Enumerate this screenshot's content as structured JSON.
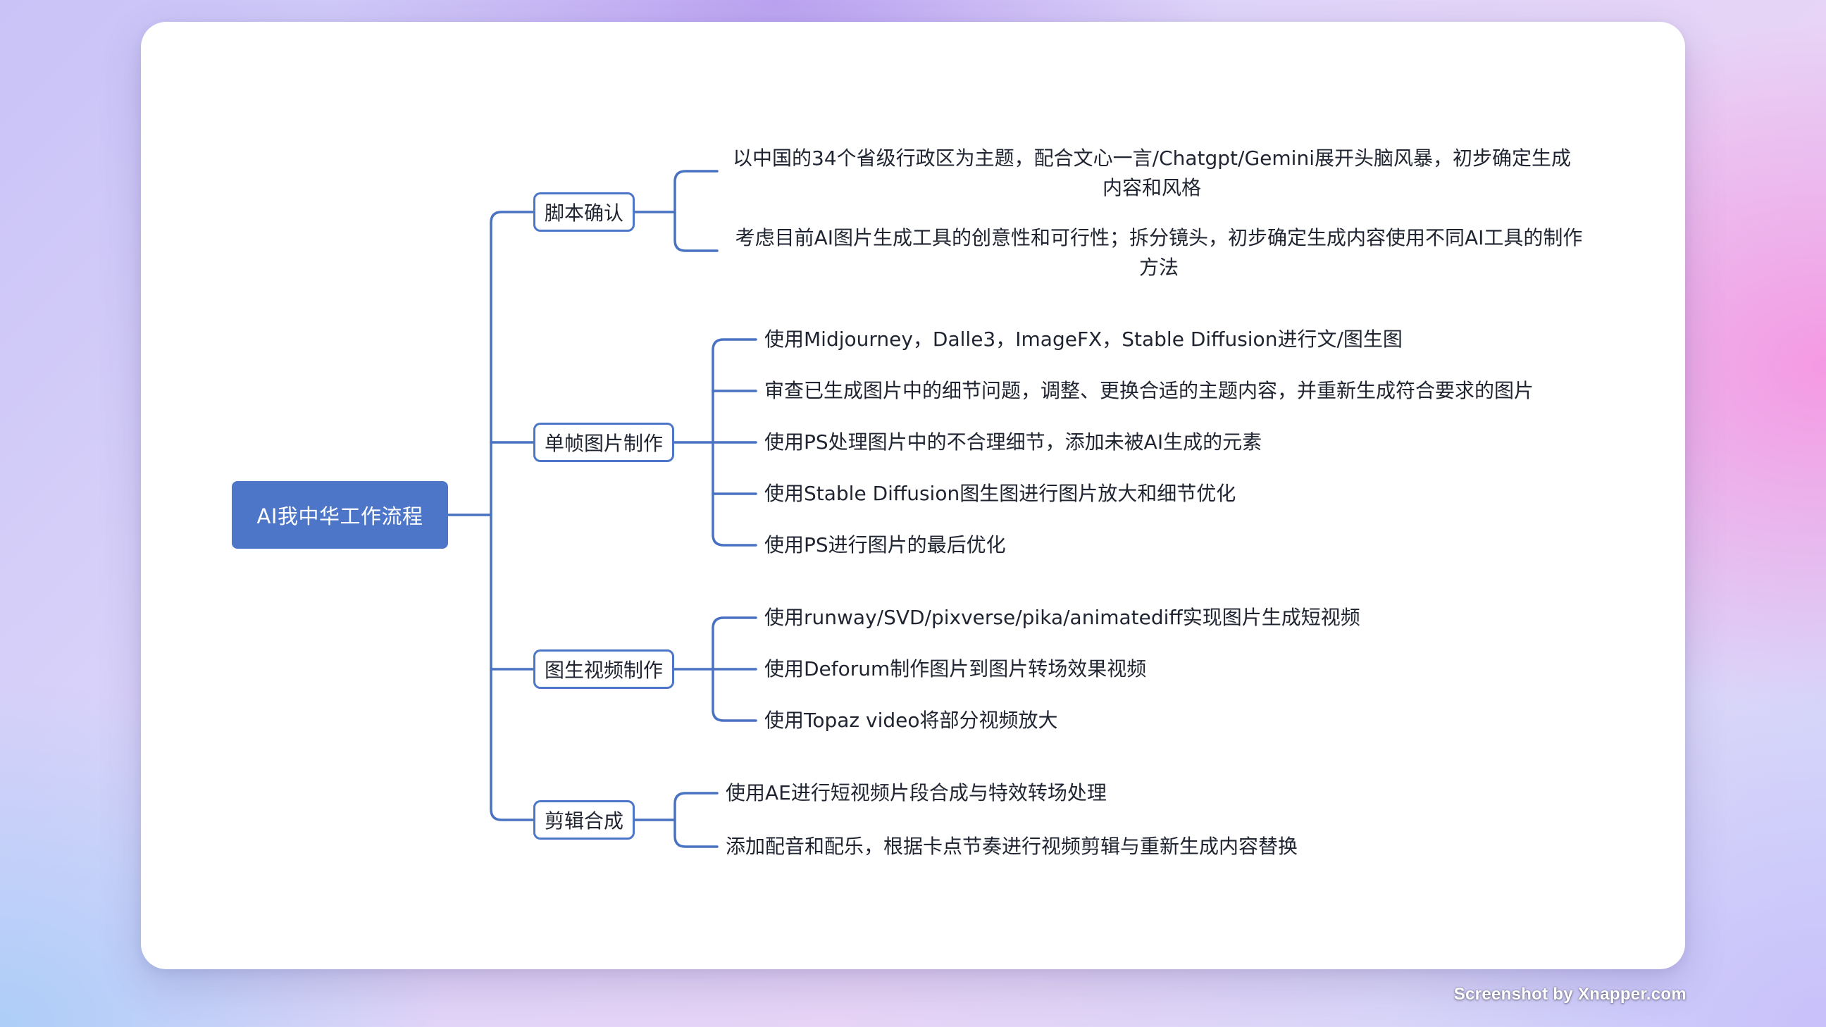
{
  "mindmap": {
    "root": "AI我中华工作流程",
    "branches": [
      {
        "label": "脚本确认",
        "children": [
          "以中国的34个省级行政区为主题，配合文心一言/Chatgpt/Gemini展开头脑风暴，初步确定生成内容和风格",
          "考虑目前AI图片生成工具的创意性和可行性；拆分镜头，初步确定生成内容使用不同AI工具的制作方法"
        ]
      },
      {
        "label": "单帧图片制作",
        "children": [
          "使用Midjourney，Dalle3，ImageFX，Stable Diffusion进行文/图生图",
          "审查已生成图片中的细节问题，调整、更换合适的主题内容，并重新生成符合要求的图片",
          "使用PS处理图片中的不合理细节，添加未被AI生成的元素",
          "使用Stable Diffusion图生图进行图片放大和细节优化",
          "使用PS进行图片的最后优化"
        ]
      },
      {
        "label": "图生视频制作",
        "children": [
          "使用runway/SVD/pixverse/pika/animatediff实现图片生成短视频",
          "使用Deforum制作图片到图片转场效果视频",
          "使用Topaz video将部分视频放大"
        ]
      },
      {
        "label": "剪辑合成",
        "children": [
          "使用AE进行短视频片段合成与特效转场处理",
          "添加配音和配乐，根据卡点节奏进行视频剪辑与重新生成内容替换"
        ]
      }
    ]
  },
  "watermark": "Screenshot by Xnapper.com",
  "colors": {
    "root_fill": "#4d76c8",
    "connector": "#4a72c2",
    "branch_border": "#4d76c8",
    "text": "#1f2430"
  }
}
